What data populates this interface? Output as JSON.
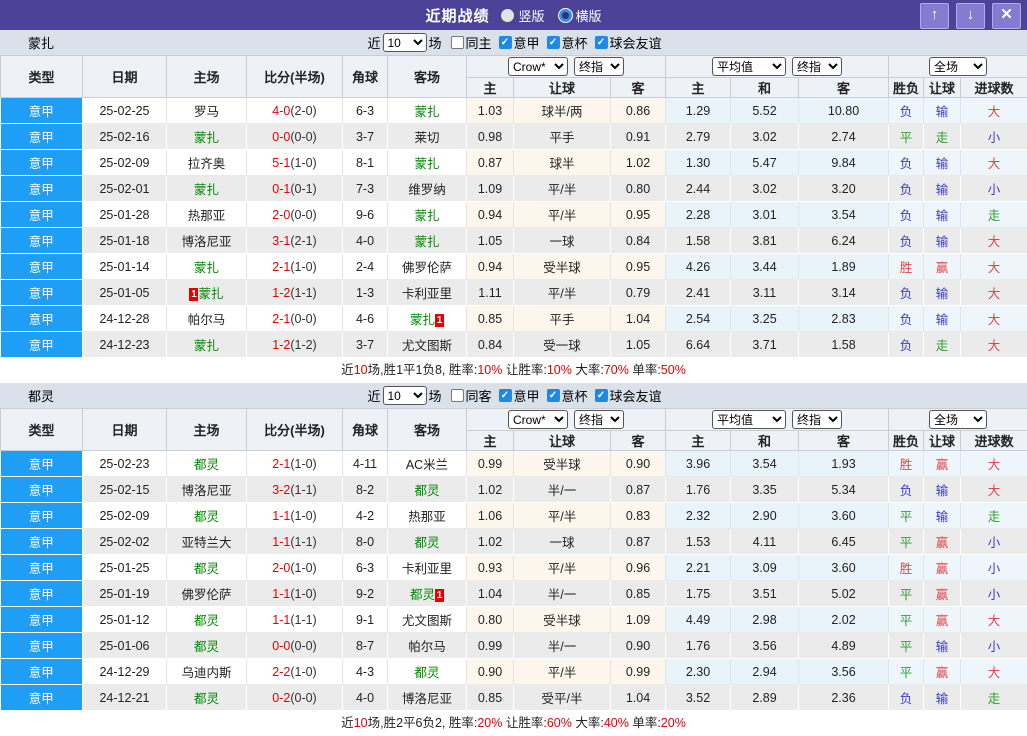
{
  "titlebar": {
    "title": "近期战绩",
    "radio_vertical_label": "竖版",
    "radio_horizontal_label": "横版",
    "up_glyph": "↑",
    "down_glyph": "↓",
    "close_glyph": "✕"
  },
  "table_template": {
    "left_headers": [
      "类型",
      "日期",
      "主场",
      "比分(半场)",
      "角球",
      "客场"
    ],
    "sub_headers": [
      "主",
      "让球",
      "客",
      "主",
      "和",
      "客",
      "胜负",
      "让球",
      "进球数"
    ],
    "dropdowns": {
      "bookmaker": "Crow*",
      "final": "终指",
      "average": "平均值",
      "final2": "终指",
      "scope": "全场"
    }
  },
  "result_color_groups": {
    "res-red": [
      "胜",
      "赢",
      "大"
    ],
    "res-blue": [
      "负",
      "输",
      "小"
    ],
    "res-green": [
      "平",
      "走"
    ]
  },
  "colors": {
    "titlebar_bg": "#4e4198",
    "titlebar_button_bg": "#867bd0",
    "section_header_bg": "#dae1ea",
    "table_header_bg": "#eef1f5",
    "type_cell_bg": "#1f9ef5",
    "even_row_bg": "#ebebeb",
    "handicap_col_bg": "#fdf6ec",
    "average_col_bg": "#e9f3fa",
    "result_col_bg": "#eff6fb",
    "focus_team": "#008800",
    "score_red": "#e60000",
    "result_red": "#e04545",
    "result_blue": "#3a3ace",
    "result_green": "#2f9e2f",
    "checkbox_checked": "#1e88e5"
  },
  "sections": [
    {
      "team": "蒙扎",
      "filter": {
        "near_label": "近",
        "count": "10",
        "count_options": [
          "10"
        ],
        "games_label": "场",
        "same_label": "同主",
        "same_checked": false,
        "leagues": [
          {
            "label": "意甲",
            "checked": true
          },
          {
            "label": "意杯",
            "checked": true
          },
          {
            "label": "球会友谊",
            "checked": true
          }
        ]
      },
      "rows": [
        {
          "league": "意甲",
          "date": "25-02-25",
          "home": "罗马",
          "home_focus": false,
          "home_card": "",
          "score": "4-0",
          "half": "(2-0)",
          "corners": "6-3",
          "away": "蒙扎",
          "away_focus": true,
          "away_card": "",
          "handicap": [
            "1.03",
            "球半/两",
            "0.86"
          ],
          "average": [
            "1.29",
            "5.52",
            "10.80"
          ],
          "results": [
            "负",
            "输",
            "大"
          ]
        },
        {
          "league": "意甲",
          "date": "25-02-16",
          "home": "蒙扎",
          "home_focus": true,
          "home_card": "",
          "score": "0-0",
          "half": "(0-0)",
          "corners": "3-7",
          "away": "莱切",
          "away_focus": false,
          "away_card": "",
          "handicap": [
            "0.98",
            "平手",
            "0.91"
          ],
          "average": [
            "2.79",
            "3.02",
            "2.74"
          ],
          "results": [
            "平",
            "走",
            "小"
          ]
        },
        {
          "league": "意甲",
          "date": "25-02-09",
          "home": "拉齐奥",
          "home_focus": false,
          "home_card": "",
          "score": "5-1",
          "half": "(1-0)",
          "corners": "8-1",
          "away": "蒙扎",
          "away_focus": true,
          "away_card": "",
          "handicap": [
            "0.87",
            "球半",
            "1.02"
          ],
          "average": [
            "1.30",
            "5.47",
            "9.84"
          ],
          "results": [
            "负",
            "输",
            "大"
          ]
        },
        {
          "league": "意甲",
          "date": "25-02-01",
          "home": "蒙扎",
          "home_focus": true,
          "home_card": "",
          "score": "0-1",
          "half": "(0-1)",
          "corners": "7-3",
          "away": "维罗纳",
          "away_focus": false,
          "away_card": "",
          "handicap": [
            "1.09",
            "平/半",
            "0.80"
          ],
          "average": [
            "2.44",
            "3.02",
            "3.20"
          ],
          "results": [
            "负",
            "输",
            "小"
          ]
        },
        {
          "league": "意甲",
          "date": "25-01-28",
          "home": "热那亚",
          "home_focus": false,
          "home_card": "",
          "score": "2-0",
          "half": "(0-0)",
          "corners": "9-6",
          "away": "蒙扎",
          "away_focus": true,
          "away_card": "",
          "handicap": [
            "0.94",
            "平/半",
            "0.95"
          ],
          "average": [
            "2.28",
            "3.01",
            "3.54"
          ],
          "results": [
            "负",
            "输",
            "走"
          ]
        },
        {
          "league": "意甲",
          "date": "25-01-18",
          "home": "博洛尼亚",
          "home_focus": false,
          "home_card": "",
          "score": "3-1",
          "half": "(2-1)",
          "corners": "4-0",
          "away": "蒙扎",
          "away_focus": true,
          "away_card": "",
          "handicap": [
            "1.05",
            "一球",
            "0.84"
          ],
          "average": [
            "1.58",
            "3.81",
            "6.24"
          ],
          "results": [
            "负",
            "输",
            "大"
          ]
        },
        {
          "league": "意甲",
          "date": "25-01-14",
          "home": "蒙扎",
          "home_focus": true,
          "home_card": "",
          "score": "2-1",
          "half": "(1-0)",
          "corners": "2-4",
          "away": "佛罗伦萨",
          "away_focus": false,
          "away_card": "",
          "handicap": [
            "0.94",
            "受半球",
            "0.95"
          ],
          "average": [
            "4.26",
            "3.44",
            "1.89"
          ],
          "results": [
            "胜",
            "赢",
            "大"
          ]
        },
        {
          "league": "意甲",
          "date": "25-01-05",
          "home": "蒙扎",
          "home_focus": true,
          "home_card": "1",
          "score": "1-2",
          "half": "(1-1)",
          "corners": "1-3",
          "away": "卡利亚里",
          "away_focus": false,
          "away_card": "",
          "handicap": [
            "1.11",
            "平/半",
            "0.79"
          ],
          "average": [
            "2.41",
            "3.11",
            "3.14"
          ],
          "results": [
            "负",
            "输",
            "大"
          ]
        },
        {
          "league": "意甲",
          "date": "24-12-28",
          "home": "帕尔马",
          "home_focus": false,
          "home_card": "",
          "score": "2-1",
          "half": "(0-0)",
          "corners": "4-6",
          "away": "蒙扎",
          "away_focus": true,
          "away_card": "1",
          "handicap": [
            "0.85",
            "平手",
            "1.04"
          ],
          "average": [
            "2.54",
            "3.25",
            "2.83"
          ],
          "results": [
            "负",
            "输",
            "大"
          ]
        },
        {
          "league": "意甲",
          "date": "24-12-23",
          "home": "蒙扎",
          "home_focus": true,
          "home_card": "",
          "score": "1-2",
          "half": "(1-2)",
          "corners": "3-7",
          "away": "尤文图斯",
          "away_focus": false,
          "away_card": "",
          "handicap": [
            "0.84",
            "受一球",
            "1.05"
          ],
          "average": [
            "6.64",
            "3.71",
            "1.58"
          ],
          "results": [
            "负",
            "走",
            "大"
          ]
        }
      ],
      "summary": [
        {
          "t": "近"
        },
        {
          "t": "10",
          "red": true
        },
        {
          "t": "场,胜1平1负8, 胜率:"
        },
        {
          "t": "10%",
          "red": true
        },
        {
          "t": " 让胜率:"
        },
        {
          "t": "10%",
          "red": true
        },
        {
          "t": " 大率:"
        },
        {
          "t": "70%",
          "red": true
        },
        {
          "t": " 单率:"
        },
        {
          "t": "50%",
          "red": true
        }
      ]
    },
    {
      "team": "都灵",
      "filter": {
        "near_label": "近",
        "count": "10",
        "count_options": [
          "10"
        ],
        "games_label": "场",
        "same_label": "同客",
        "same_checked": false,
        "leagues": [
          {
            "label": "意甲",
            "checked": true
          },
          {
            "label": "意杯",
            "checked": true
          },
          {
            "label": "球会友谊",
            "checked": true
          }
        ]
      },
      "rows": [
        {
          "league": "意甲",
          "date": "25-02-23",
          "home": "都灵",
          "home_focus": true,
          "home_card": "",
          "score": "2-1",
          "half": "(1-0)",
          "corners": "4-11",
          "away": "AC米兰",
          "away_focus": false,
          "away_card": "",
          "handicap": [
            "0.99",
            "受半球",
            "0.90"
          ],
          "average": [
            "3.96",
            "3.54",
            "1.93"
          ],
          "results": [
            "胜",
            "赢",
            "大"
          ]
        },
        {
          "league": "意甲",
          "date": "25-02-15",
          "home": "博洛尼亚",
          "home_focus": false,
          "home_card": "",
          "score": "3-2",
          "half": "(1-1)",
          "corners": "8-2",
          "away": "都灵",
          "away_focus": true,
          "away_card": "",
          "handicap": [
            "1.02",
            "半/一",
            "0.87"
          ],
          "average": [
            "1.76",
            "3.35",
            "5.34"
          ],
          "results": [
            "负",
            "输",
            "大"
          ]
        },
        {
          "league": "意甲",
          "date": "25-02-09",
          "home": "都灵",
          "home_focus": true,
          "home_card": "",
          "score": "1-1",
          "half": "(1-0)",
          "corners": "4-2",
          "away": "热那亚",
          "away_focus": false,
          "away_card": "",
          "handicap": [
            "1.06",
            "平/半",
            "0.83"
          ],
          "average": [
            "2.32",
            "2.90",
            "3.60"
          ],
          "results": [
            "平",
            "输",
            "走"
          ]
        },
        {
          "league": "意甲",
          "date": "25-02-02",
          "home": "亚特兰大",
          "home_focus": false,
          "home_card": "",
          "score": "1-1",
          "half": "(1-1)",
          "corners": "8-0",
          "away": "都灵",
          "away_focus": true,
          "away_card": "",
          "handicap": [
            "1.02",
            "一球",
            "0.87"
          ],
          "average": [
            "1.53",
            "4.11",
            "6.45"
          ],
          "results": [
            "平",
            "赢",
            "小"
          ]
        },
        {
          "league": "意甲",
          "date": "25-01-25",
          "home": "都灵",
          "home_focus": true,
          "home_card": "",
          "score": "2-0",
          "half": "(1-0)",
          "corners": "6-3",
          "away": "卡利亚里",
          "away_focus": false,
          "away_card": "",
          "handicap": [
            "0.93",
            "平/半",
            "0.96"
          ],
          "average": [
            "2.21",
            "3.09",
            "3.60"
          ],
          "results": [
            "胜",
            "赢",
            "小"
          ]
        },
        {
          "league": "意甲",
          "date": "25-01-19",
          "home": "佛罗伦萨",
          "home_focus": false,
          "home_card": "",
          "score": "1-1",
          "half": "(1-0)",
          "corners": "9-2",
          "away": "都灵",
          "away_focus": true,
          "away_card": "1",
          "handicap": [
            "1.04",
            "半/一",
            "0.85"
          ],
          "average": [
            "1.75",
            "3.51",
            "5.02"
          ],
          "results": [
            "平",
            "赢",
            "小"
          ]
        },
        {
          "league": "意甲",
          "date": "25-01-12",
          "home": "都灵",
          "home_focus": true,
          "home_card": "",
          "score": "1-1",
          "half": "(1-1)",
          "corners": "9-1",
          "away": "尤文图斯",
          "away_focus": false,
          "away_card": "",
          "handicap": [
            "0.80",
            "受半球",
            "1.09"
          ],
          "average": [
            "4.49",
            "2.98",
            "2.02"
          ],
          "results": [
            "平",
            "赢",
            "大"
          ]
        },
        {
          "league": "意甲",
          "date": "25-01-06",
          "home": "都灵",
          "home_focus": true,
          "home_card": "",
          "score": "0-0",
          "half": "(0-0)",
          "corners": "8-7",
          "away": "帕尔马",
          "away_focus": false,
          "away_card": "",
          "handicap": [
            "0.99",
            "半/一",
            "0.90"
          ],
          "average": [
            "1.76",
            "3.56",
            "4.89"
          ],
          "results": [
            "平",
            "输",
            "小"
          ]
        },
        {
          "league": "意甲",
          "date": "24-12-29",
          "home": "乌迪内斯",
          "home_focus": false,
          "home_card": "",
          "score": "2-2",
          "half": "(1-0)",
          "corners": "4-3",
          "away": "都灵",
          "away_focus": true,
          "away_card": "",
          "handicap": [
            "0.90",
            "平/半",
            "0.99"
          ],
          "average": [
            "2.30",
            "2.94",
            "3.56"
          ],
          "results": [
            "平",
            "赢",
            "大"
          ]
        },
        {
          "league": "意甲",
          "date": "24-12-21",
          "home": "都灵",
          "home_focus": true,
          "home_card": "",
          "score": "0-2",
          "half": "(0-0)",
          "corners": "4-0",
          "away": "博洛尼亚",
          "away_focus": false,
          "away_card": "",
          "handicap": [
            "0.85",
            "受平/半",
            "1.04"
          ],
          "average": [
            "3.52",
            "2.89",
            "2.36"
          ],
          "results": [
            "负",
            "输",
            "走"
          ]
        }
      ],
      "summary": [
        {
          "t": "近"
        },
        {
          "t": "10",
          "red": true
        },
        {
          "t": "场,胜2平6负2, 胜率:"
        },
        {
          "t": "20%",
          "red": true
        },
        {
          "t": " 让胜率:"
        },
        {
          "t": "60%",
          "red": true
        },
        {
          "t": " 大率:"
        },
        {
          "t": "40%",
          "red": true
        },
        {
          "t": " 单率:"
        },
        {
          "t": "20%",
          "red": true
        }
      ]
    }
  ]
}
